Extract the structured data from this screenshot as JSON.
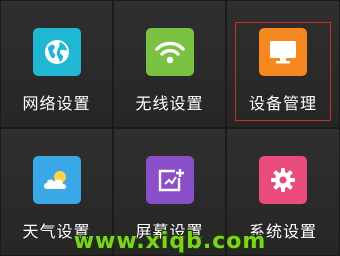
{
  "tiles": [
    {
      "label": "网络设置",
      "icon": "globe-icon",
      "color": "#1fb7d4",
      "selected": false
    },
    {
      "label": "无线设置",
      "icon": "wifi-icon",
      "color": "#7bc142",
      "selected": false
    },
    {
      "label": "设备管理",
      "icon": "monitor-icon",
      "color": "#f5891f",
      "selected": true
    },
    {
      "label": "天气设置",
      "icon": "weather-icon",
      "color": "#3aa8e6",
      "selected": false
    },
    {
      "label": "屏幕设置",
      "icon": "screen-edit-icon",
      "color": "#8b4fc9",
      "selected": false
    },
    {
      "label": "系统设置",
      "icon": "gear-icon",
      "color": "#e94b7c",
      "selected": false
    }
  ],
  "watermark": "www.xiqb.com",
  "colors": {
    "selection_border": "#c8302a",
    "watermark": "#7ed321"
  }
}
